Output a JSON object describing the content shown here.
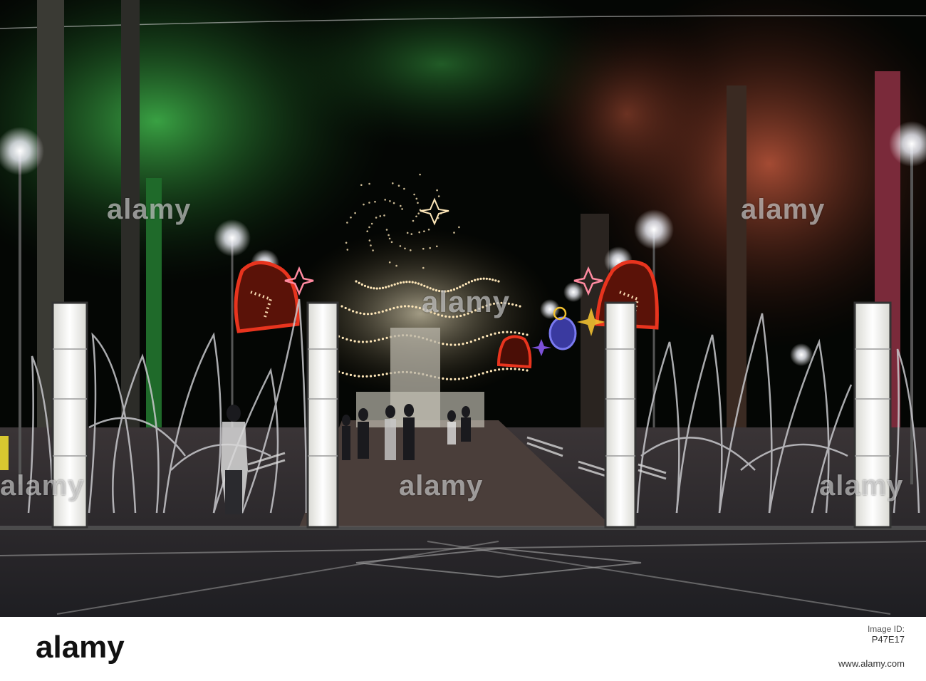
{
  "watermark": {
    "text": "alamy"
  },
  "footer": {
    "logo": "alamy",
    "image_id_label": "Image ID:",
    "image_id": "P47E17",
    "site": "www.alamy.com"
  },
  "colors": {
    "sky": "#050805",
    "ground": "#2a2a2e",
    "tree_green": "#2f8f3a",
    "tree_red": "#8a3a2a",
    "light_column": "#f4f4f0",
    "bell_red": "#d8301c",
    "star_yellow": "#f0c030",
    "garland": "#fde6b8"
  }
}
